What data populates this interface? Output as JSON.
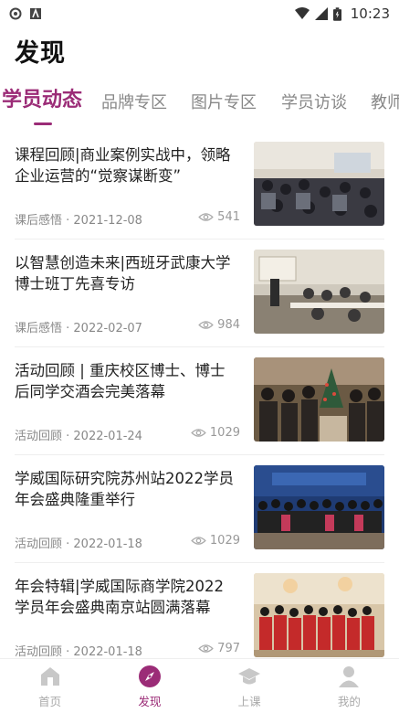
{
  "status_bar": {
    "time": "10:23"
  },
  "page": {
    "title": "发现"
  },
  "tabs": [
    {
      "label": "学员动态",
      "active": true
    },
    {
      "label": "品牌专区",
      "active": false
    },
    {
      "label": "图片专区",
      "active": false
    },
    {
      "label": "学员访谈",
      "active": false
    },
    {
      "label": "教师",
      "active": false
    }
  ],
  "articles": [
    {
      "title": "课程回顾|商业案例实战中，领略企业运营的“觉察谋断变”",
      "category_date": "课后感悟 · 2021-12-08",
      "views": "541",
      "image": "classroom-photo"
    },
    {
      "title": "以智慧创造未来|西班牙武康大学博士班丁先喜专访",
      "category_date": "课后感悟 · 2022-02-07",
      "views": "984",
      "image": "lecture-photo"
    },
    {
      "title": "活动回顾 | 重庆校区博士、博士后同学交酒会完美落幕",
      "category_date": "活动回顾 · 2022-01-24",
      "views": "1029",
      "image": "christmas-party-photo"
    },
    {
      "title": "学威国际研究院苏州站2022学员年会盛典隆重举行",
      "category_date": "活动回顾 · 2022-01-18",
      "views": "1029",
      "image": "group-photo-stage"
    },
    {
      "title": "年会特辑|学威国际商学院2022学员年会盛典南京站圆满落幕",
      "category_date": "活动回顾 · 2022-01-18",
      "views": "797",
      "image": "group-photo-red"
    }
  ],
  "tabbar": [
    {
      "label": "首页",
      "icon": "home-icon",
      "active": false
    },
    {
      "label": "发现",
      "icon": "compass-icon",
      "active": true
    },
    {
      "label": "上课",
      "icon": "graduation-cap-icon",
      "active": false
    },
    {
      "label": "我的",
      "icon": "user-icon",
      "active": false
    }
  ],
  "colors": {
    "accent": "#9b2c77",
    "muted": "#aaaaaa"
  }
}
